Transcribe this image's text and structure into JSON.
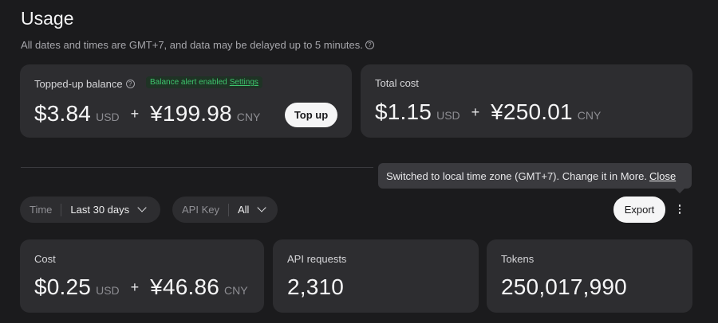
{
  "page": {
    "title": "Usage",
    "subtitle": "All dates and times are GMT+7, and data may be delayed up to 5 minutes."
  },
  "balance_card": {
    "label": "Topped-up balance",
    "alert_text": "Balance alert enabled",
    "alert_link": "Settings",
    "usd_amount": "$3.84",
    "usd_unit": "USD",
    "plus": "+",
    "cny_amount": "¥199.98",
    "cny_unit": "CNY",
    "topup_label": "Top up"
  },
  "total_cost_card": {
    "label": "Total cost",
    "usd_amount": "$1.15",
    "usd_unit": "USD",
    "plus": "+",
    "cny_amount": "¥250.01",
    "cny_unit": "CNY"
  },
  "tooltip": {
    "text": "Switched to local time zone (GMT+7). Change it in More.",
    "close_label": "Close"
  },
  "filters": {
    "time_label": "Time",
    "time_value": "Last 30 days",
    "apikey_label": "API Key",
    "apikey_value": "All"
  },
  "toolbar": {
    "export_label": "Export"
  },
  "stats": {
    "cost": {
      "label": "Cost",
      "usd_amount": "$0.25",
      "usd_unit": "USD",
      "plus": "+",
      "cny_amount": "¥46.86",
      "cny_unit": "CNY"
    },
    "api_requests": {
      "label": "API requests",
      "value": "2,310"
    },
    "tokens": {
      "label": "Tokens",
      "value": "250,017,990"
    }
  },
  "colors": {
    "background": "#1b1b1d",
    "card": "#2d2d30",
    "accent_green": "#3ec46d",
    "button_light": "#f5f5f6"
  }
}
